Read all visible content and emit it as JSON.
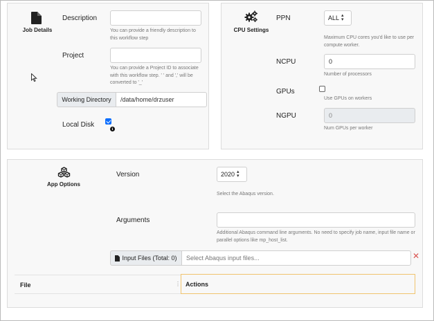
{
  "job": {
    "title": "Job Details",
    "description_label": "Description",
    "description_value": "",
    "description_help": "You can provide a friendly description to this workflow step",
    "project_label": "Project",
    "project_value": "",
    "project_help": "You can provide a Project ID to associate with this workflow step. ' ' and ',' will be converted to '_'",
    "workdir_label": "Working Directory",
    "workdir_value": "/data/home/drzuser",
    "localdisk_label": "Local Disk",
    "localdisk_checked": true
  },
  "cpu": {
    "title": "CPU Settings",
    "ppn_label": "PPN",
    "ppn_value": "ALL",
    "ppn_help": "Maximum CPU cores you'd like to use per compute worker.",
    "ncpu_label": "NCPU",
    "ncpu_value": "0",
    "ncpu_help": "Number of processors",
    "gpus_label": "GPUs",
    "gpus_checked": false,
    "gpus_help": "Use GPUs on workers",
    "ngpu_label": "NGPU",
    "ngpu_placeholder": "0",
    "ngpu_help": "Num GPUs per worker"
  },
  "app": {
    "title": "App Options",
    "version_label": "Version",
    "version_value": "2020",
    "version_help": "Select the Abaqus version.",
    "arguments_label": "Arguments",
    "arguments_value": "",
    "arguments_help": "Additional Abaqus command line arguments. No need to specify job name, input file name or parallel options like mp_host_list.",
    "input_files_button": "Input Files (Total: 0)",
    "input_files_placeholder": "Select Abaqus input files...",
    "table_headers": [
      "File",
      "Actions"
    ]
  },
  "icons": {
    "job": "file-icon",
    "cpu": "gears-icon",
    "app": "cubes-icon"
  },
  "colors": {
    "accent": "#0d6efd",
    "danger": "#d9534f",
    "highlight_border": "#f0c36d"
  }
}
